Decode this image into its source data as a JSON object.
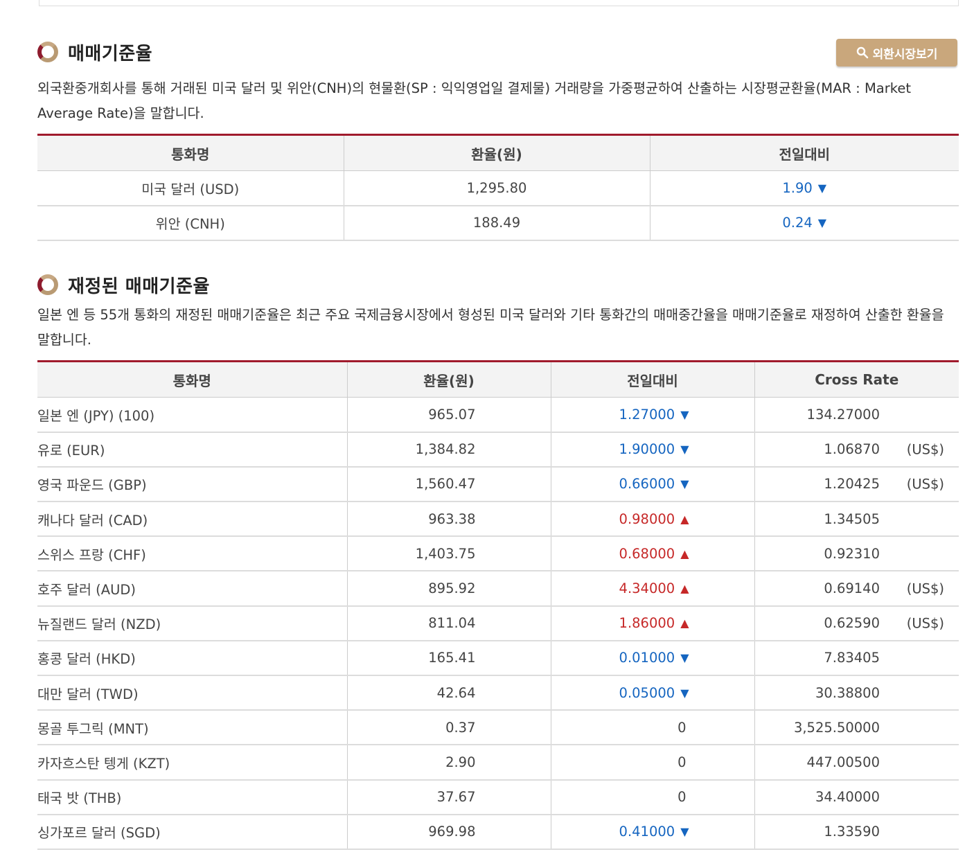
{
  "section1": {
    "title": "매매기준율",
    "button_label": "외환시장보기",
    "description": "외국환중개회사를 통해 거래된 미국 달러 및 위안(CNH)의 현물환(SP : 익익영업일 결제물) 거래량을 가중평균하여 산출하는 시장평균환율(MAR : Market Average Rate)을 말합니다.",
    "headers": [
      "통화명",
      "환율(원)",
      "전일대비"
    ],
    "rows": [
      {
        "name": "미국 달러 (USD)",
        "rate": "1,295.80",
        "change": "1.90",
        "direction": "down"
      },
      {
        "name": "위안 (CNH)",
        "rate": "188.49",
        "change": "0.24",
        "direction": "down"
      }
    ]
  },
  "section2": {
    "title": "재정된 매매기준율",
    "description": "일본 엔 등 55개 통화의 재정된 매매기준율은 최근 주요 국제금융시장에서 형성된 미국 달러와 기타 통화간의 매매중간율을 매매기준율로 재정하여 산출한 환율을 말합니다.",
    "headers": [
      "통화명",
      "환율(원)",
      "전일대비",
      "Cross Rate"
    ],
    "rows": [
      {
        "name": "일본 엔 (JPY) (100)",
        "rate": "965.07",
        "change": "1.27000",
        "direction": "down",
        "cross": "134.27000",
        "unit": ""
      },
      {
        "name": "유로 (EUR)",
        "rate": "1,384.82",
        "change": "1.90000",
        "direction": "down",
        "cross": "1.06870",
        "unit": "(US$)"
      },
      {
        "name": "영국 파운드 (GBP)",
        "rate": "1,560.47",
        "change": "0.66000",
        "direction": "down",
        "cross": "1.20425",
        "unit": "(US$)"
      },
      {
        "name": "캐나다 달러 (CAD)",
        "rate": "963.38",
        "change": "0.98000",
        "direction": "up",
        "cross": "1.34505",
        "unit": ""
      },
      {
        "name": "스위스 프랑 (CHF)",
        "rate": "1,403.75",
        "change": "0.68000",
        "direction": "up",
        "cross": "0.92310",
        "unit": ""
      },
      {
        "name": "호주 달러 (AUD)",
        "rate": "895.92",
        "change": "4.34000",
        "direction": "up",
        "cross": "0.69140",
        "unit": "(US$)"
      },
      {
        "name": "뉴질랜드 달러 (NZD)",
        "rate": "811.04",
        "change": "1.86000",
        "direction": "up",
        "cross": "0.62590",
        "unit": "(US$)"
      },
      {
        "name": "홍콩 달러 (HKD)",
        "rate": "165.41",
        "change": "0.01000",
        "direction": "down",
        "cross": "7.83405",
        "unit": ""
      },
      {
        "name": "대만 달러 (TWD)",
        "rate": "42.64",
        "change": "0.05000",
        "direction": "down",
        "cross": "30.38800",
        "unit": ""
      },
      {
        "name": "몽골 투그릭 (MNT)",
        "rate": "0.37",
        "change": "0",
        "direction": "flat",
        "cross": "3,525.50000",
        "unit": ""
      },
      {
        "name": "카자흐스탄 텡게 (KZT)",
        "rate": "2.90",
        "change": "0",
        "direction": "flat",
        "cross": "447.00500",
        "unit": ""
      },
      {
        "name": "태국 밧 (THB)",
        "rate": "37.67",
        "change": "0",
        "direction": "flat",
        "cross": "34.40000",
        "unit": ""
      },
      {
        "name": "싱가포르 달러 (SGD)",
        "rate": "969.98",
        "change": "0.41000",
        "direction": "down",
        "cross": "1.33590",
        "unit": ""
      }
    ]
  },
  "colors": {
    "accent": "#a01a2c",
    "button": "#c9a77c",
    "down": "#1565c0",
    "up": "#c62828"
  },
  "icons": {
    "down": "triangle-down-icon",
    "up": "triangle-up-icon",
    "section": "ring-bullet-icon",
    "button": "search-icon"
  }
}
